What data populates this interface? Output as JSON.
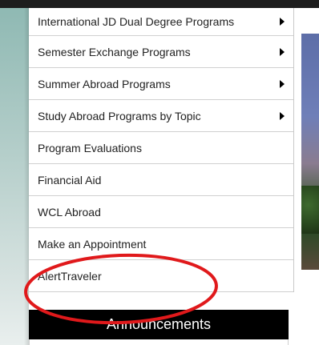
{
  "menu": {
    "items": [
      {
        "label": "International JD Dual Degree Programs",
        "has_submenu": true
      },
      {
        "label": "Semester Exchange Programs",
        "has_submenu": true
      },
      {
        "label": "Summer Abroad Programs",
        "has_submenu": true
      },
      {
        "label": "Study Abroad Programs by Topic",
        "has_submenu": true
      },
      {
        "label": "Program Evaluations",
        "has_submenu": false
      },
      {
        "label": "Financial Aid",
        "has_submenu": false
      },
      {
        "label": "WCL Abroad",
        "has_submenu": false
      },
      {
        "label": "Make an Appointment",
        "has_submenu": false
      },
      {
        "label": "AlertTraveler",
        "has_submenu": false
      }
    ]
  },
  "announcements": {
    "title": "Announcements"
  },
  "icons": {
    "submenu": "chevron-right-icon"
  },
  "colors": {
    "header_bar": "#1d1d1d",
    "announcements_bg": "#000000",
    "annotation_circle": "#e0191b"
  }
}
